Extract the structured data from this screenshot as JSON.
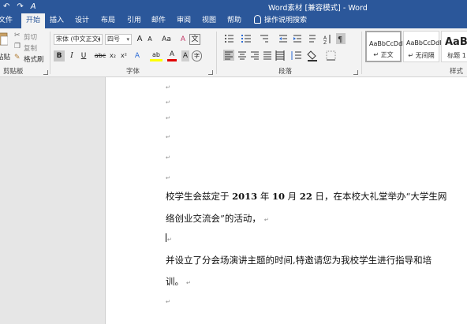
{
  "window": {
    "title": "Word素材 [兼容模式] - Word"
  },
  "quick_access": {
    "undo_icon": "↶",
    "redo_icon": "↷",
    "format_icon": "A"
  },
  "tabs": [
    {
      "label": "文件"
    },
    {
      "label": "开始",
      "active": true
    },
    {
      "label": "插入"
    },
    {
      "label": "设计"
    },
    {
      "label": "布局"
    },
    {
      "label": "引用"
    },
    {
      "label": "邮件"
    },
    {
      "label": "审阅"
    },
    {
      "label": "视图"
    },
    {
      "label": "帮助"
    }
  ],
  "tell_me": "操作说明搜索",
  "clipboard": {
    "paste_label": "粘贴",
    "cut_label": "剪切",
    "copy_label": "复制",
    "format_painter_label": "格式刷",
    "group_label": "剪贴板"
  },
  "font": {
    "font_name": "宋体 (中文正文)",
    "font_size": "四号",
    "grow": "A",
    "shrink": "A",
    "case": "Aa",
    "clear": "A",
    "wen": "文",
    "bold": "B",
    "italic": "I",
    "underline": "U",
    "strike": "abc",
    "subscript": "x₂",
    "superscript": "x²",
    "effects": "A",
    "highlight": "ab",
    "color": "A",
    "charshade": "A",
    "circle": "字",
    "group_label": "字体"
  },
  "paragraph": {
    "group_label": "段落"
  },
  "styles": {
    "group_label": "样式",
    "items": [
      {
        "preview": "AaBbCcDdI",
        "name": "↵ 正文"
      },
      {
        "preview": "AaBbCcDdI",
        "name": "↵ 无间隔"
      },
      {
        "preview": "AaBl",
        "name": "标题 1"
      }
    ]
  },
  "document": {
    "paragraph_mark": "↵",
    "line1_a": "校学生会兹定于 ",
    "line1_year": "2013",
    "line1_b": " 年 ",
    "line1_month": "10",
    "line1_c": " 月 ",
    "line1_day": "22",
    "line1_d": " 日，在本校大礼堂举办“大学生网",
    "line2": "络创业交流会”的活动，",
    "line3": "并设立了分会场演讲主题的时间,特邀请您为我校学生进行指导和培",
    "line4": "训。"
  },
  "colors": {
    "brand": "#2b579a",
    "ribbon_bg": "#f3f3f3",
    "highlight_yellow": "#ffff00",
    "font_red": "#e00000"
  }
}
